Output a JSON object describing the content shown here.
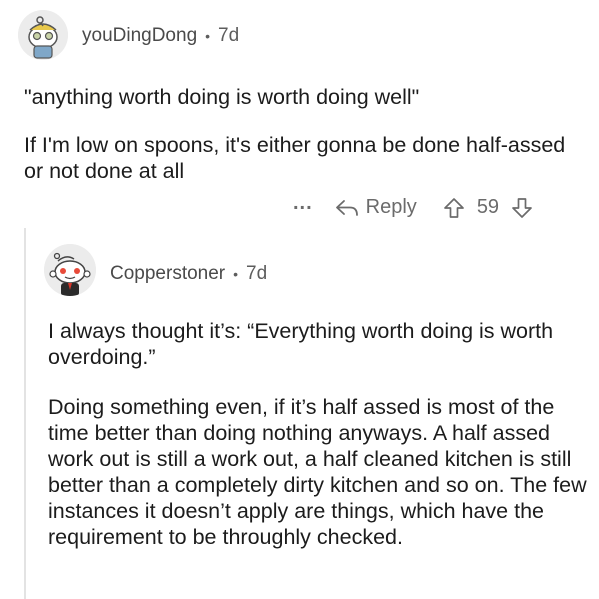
{
  "comment1": {
    "username": "youDingDong",
    "separator": "•",
    "age": "7d",
    "paragraphs": [
      "\"anything worth doing is worth doing well\"",
      "If I'm low on spoons, it's either gonna be done half-assed or not done at all"
    ],
    "actions": {
      "more": "...",
      "reply_label": "Reply",
      "score": "59"
    }
  },
  "comment2": {
    "username": "Copperstoner",
    "separator": "•",
    "age": "7d",
    "paragraphs": [
      "I always thought it’s: “Everything worth doing is worth overdoing.”",
      "Doing something even, if it’s half assed is most of the time better than doing nothing anyways. A half assed work out is still a work out, a half cleaned kitchen is still better than a completely dirty kitchen and so on. The few instances it doesn’t apply are things, which have the requirement to be throughly checked."
    ]
  },
  "colors": {
    "meta": "#5d5d5d",
    "text": "#1c1c1c",
    "icon": "#6b6b6b",
    "avatar_bg": "#ececec"
  },
  "icons": [
    "reddit-avatar-icon",
    "more-options-icon",
    "reply-arrow-icon",
    "upvote-arrow-icon",
    "downvote-arrow-icon"
  ]
}
